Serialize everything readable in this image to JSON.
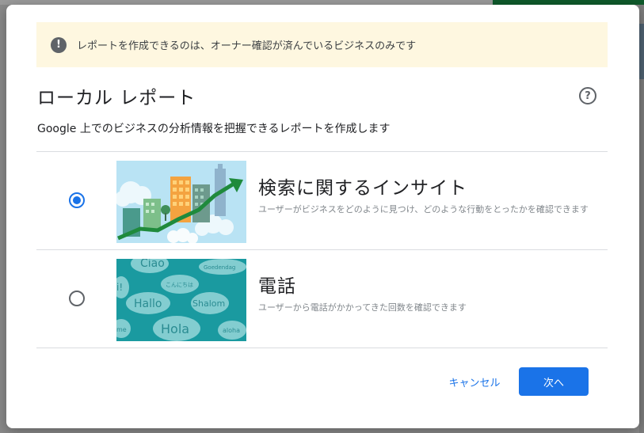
{
  "banner": {
    "icon": "alert-icon",
    "text": "レポートを作成できるのは、オーナー確認が済んでいるビジネスのみです"
  },
  "dialog": {
    "title": "ローカル レポート",
    "help_icon": "help-icon",
    "help_glyph": "?",
    "subtitle": "Google 上でのビジネスの分析情報を把握できるレポートを作成します"
  },
  "options": [
    {
      "title": "検索に関するインサイト",
      "description": "ユーザーがビジネスをどのように見つけ、どのような行動をとったかを確認できます",
      "selected": true,
      "image": "city-growth-illustration"
    },
    {
      "title": "電話",
      "description": "ユーザーから電話がかかってきた回数を確認できます",
      "selected": false,
      "image": "greeting-bubbles-illustration",
      "bubbles": [
        "Ciao",
        "Goedendag",
        "こんにちは",
        "Hallo",
        "Shalom",
        "Hola",
        "aloha",
        "i!",
        "me"
      ]
    }
  ],
  "footer": {
    "cancel_label": "キャンセル",
    "next_label": "次へ"
  },
  "colors": {
    "primary": "#1a73e8",
    "banner_bg": "#fef7e0",
    "bubble_teal": "#1a9aa0"
  }
}
